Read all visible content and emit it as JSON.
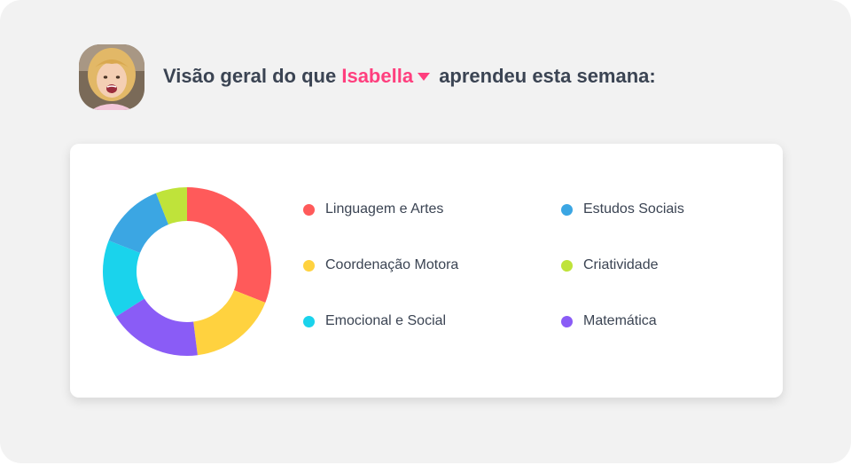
{
  "header": {
    "prefix": "Visão geral do que",
    "child_name": "Isabella",
    "suffix": "aprendeu esta semana:"
  },
  "chart_data": {
    "type": "pie",
    "categories": [
      "Linguagem e Artes",
      "Coordenação Motora",
      "Matemática",
      "Emocional e Social",
      "Estudos Sociais",
      "Criatividade"
    ],
    "values": [
      31,
      17,
      18,
      15,
      13,
      6
    ],
    "colors": [
      "#ff5a5a",
      "#ffd23f",
      "#8a5cf6",
      "#1ad3ec",
      "#3ba6e3",
      "#bfe33a"
    ]
  },
  "legend": [
    {
      "label": "Linguagem e Artes",
      "color": "#ff5a5a"
    },
    {
      "label": "Coordenação Motora",
      "color": "#ffd23f"
    },
    {
      "label": "Emocional e Social",
      "color": "#1ad3ec"
    },
    {
      "label": "Estudos Sociais",
      "color": "#3ba6e3"
    },
    {
      "label": "Criatividade",
      "color": "#bfe33a"
    },
    {
      "label": "Matemática",
      "color": "#8a5cf6"
    }
  ]
}
